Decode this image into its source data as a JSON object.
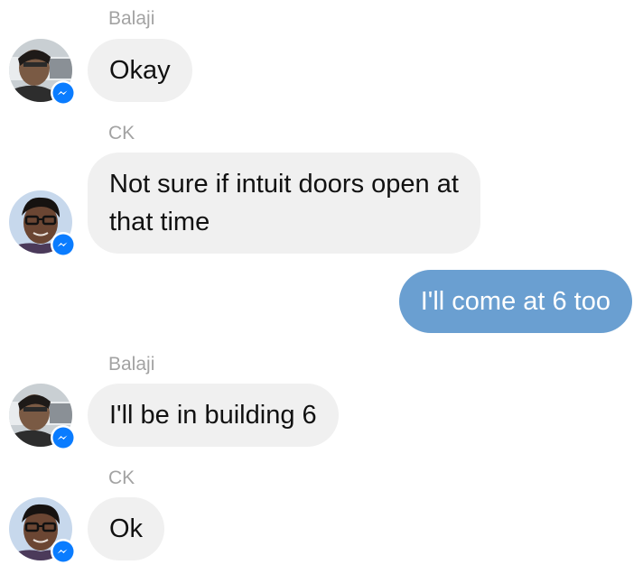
{
  "conversation": {
    "groups": [
      {
        "sender": "Balaji",
        "messages": [
          "Okay"
        ]
      },
      {
        "sender": "CK",
        "messages": [
          "Not sure if intuit doors open at",
          "that time"
        ]
      },
      {
        "sender": "",
        "outgoing": "I'll come at 6 too"
      },
      {
        "sender": "Balaji",
        "messages": [
          "I'll be in building 6"
        ]
      },
      {
        "sender": "CK",
        "messages": [
          "Ok"
        ]
      }
    ]
  },
  "icons": {
    "avatar_balaji": "user-avatar-photo",
    "avatar_ck": "user-avatar-photo",
    "badge": "messenger-icon"
  },
  "colors": {
    "incoming_bubble": "#f0f0f0",
    "outgoing_bubble": "#6a9fd1",
    "sender_name": "#a3a3a3",
    "messenger_badge": "#0a7cff"
  }
}
